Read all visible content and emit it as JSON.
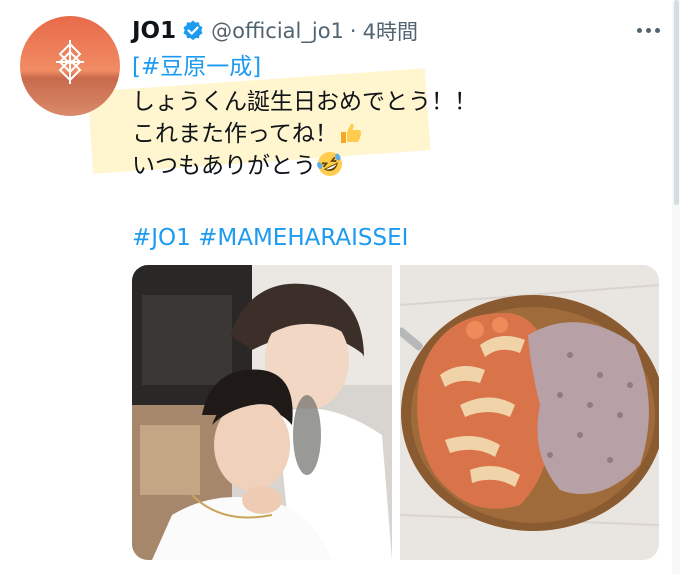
{
  "tweet": {
    "display_name": "JO1",
    "handle": "@official_jo1",
    "separator": "·",
    "time": "4時間",
    "bracket_open": "[",
    "hashtag_main": "#豆原一成",
    "bracket_close": "]",
    "lines": [
      "しょうくん誕生日おめでとう！！",
      "これまた作ってね！",
      "いつもありがとう"
    ],
    "hashtag_1": "#JO1",
    "hashtag_2": "#MAMEHARAISSEI",
    "media_count": 2
  },
  "colors": {
    "link": "#1d9bf0",
    "verified": "#1d9bf0",
    "secondary_text": "#536471",
    "highlight": "#fff3c6"
  },
  "icons": [
    "verified-badge-icon",
    "more-options-icon",
    "thumbs-up-emoji",
    "rofl-emoji"
  ]
}
